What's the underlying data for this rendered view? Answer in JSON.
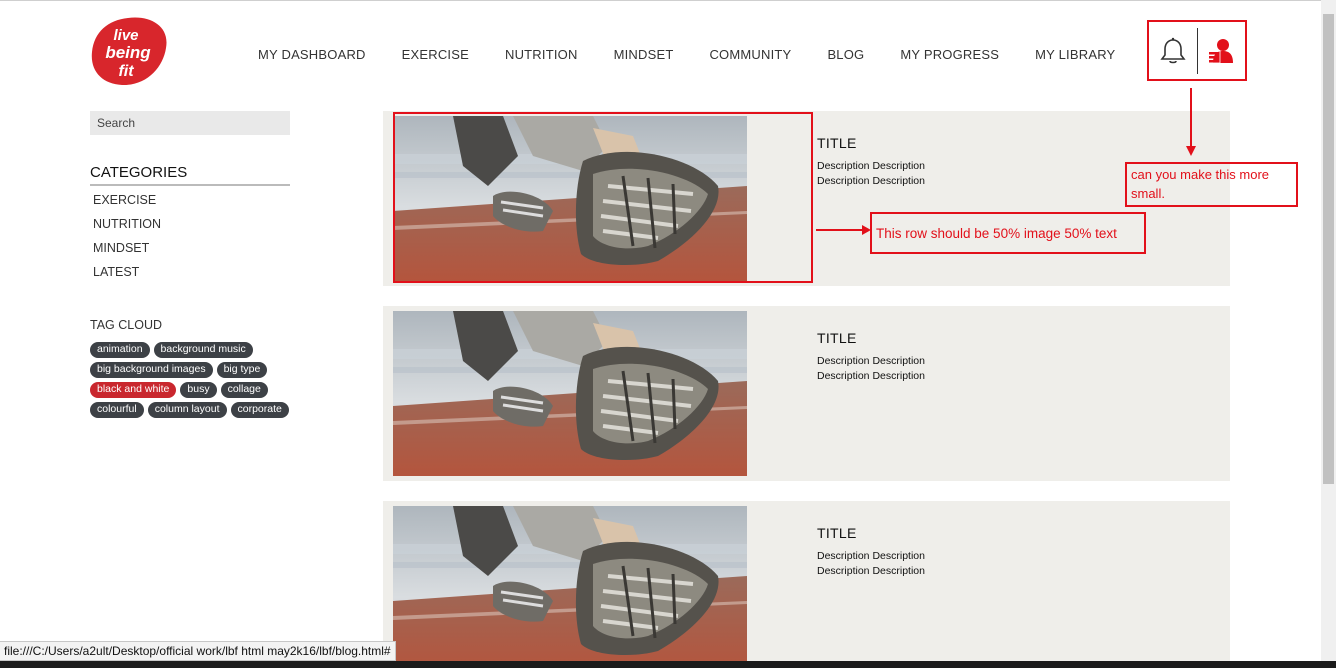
{
  "logo": {
    "alt": "live being fit",
    "line1": "live",
    "line2": "being",
    "line3": "fit"
  },
  "nav": {
    "items": [
      "MY DASHBOARD",
      "EXERCISE",
      "NUTRITION",
      "MINDSET",
      "COMMUNITY",
      "BLOG",
      "MY PROGRESS",
      "MY LIBRARY"
    ]
  },
  "header_icons": {
    "bell": "bell-icon",
    "user": "user-profile-icon"
  },
  "sidebar": {
    "search_placeholder": "Search",
    "categories_title": "CATEGORIES",
    "categories": [
      "EXERCISE",
      "NUTRITION",
      "MINDSET",
      "LATEST"
    ],
    "tag_cloud_title": "TAG CLOUD",
    "tags": [
      {
        "label": "animation",
        "active": false
      },
      {
        "label": "background music",
        "active": false
      },
      {
        "label": "big background images",
        "active": false
      },
      {
        "label": "big type",
        "active": false
      },
      {
        "label": "black and white",
        "active": true
      },
      {
        "label": "busy",
        "active": false
      },
      {
        "label": "collage",
        "active": false
      },
      {
        "label": "colourful",
        "active": false
      },
      {
        "label": "column layout",
        "active": false
      },
      {
        "label": "corporate",
        "active": false
      }
    ]
  },
  "posts": [
    {
      "title": "TITLE",
      "desc1": "Description Description",
      "desc2": "Description Description"
    },
    {
      "title": "TITLE",
      "desc1": "Description Description",
      "desc2": "Description Description"
    },
    {
      "title": "TITLE",
      "desc1": "Description Description",
      "desc2": "Description Description"
    }
  ],
  "annotations": {
    "row_note": "This row should be 50% image 50% text",
    "icon_note_line1": "can you make this more",
    "icon_note_line2": "small."
  },
  "status_bar": {
    "url": "file:///C:/Users/a2ult/Desktop/official work/lbf html may2k16/lbf/blog.html#"
  },
  "colors": {
    "accent": "#e2101a",
    "logo_red": "#d8262c",
    "post_bg": "#efeeea",
    "tag_bg": "#3d4146",
    "tag_active": "#c9272e"
  }
}
